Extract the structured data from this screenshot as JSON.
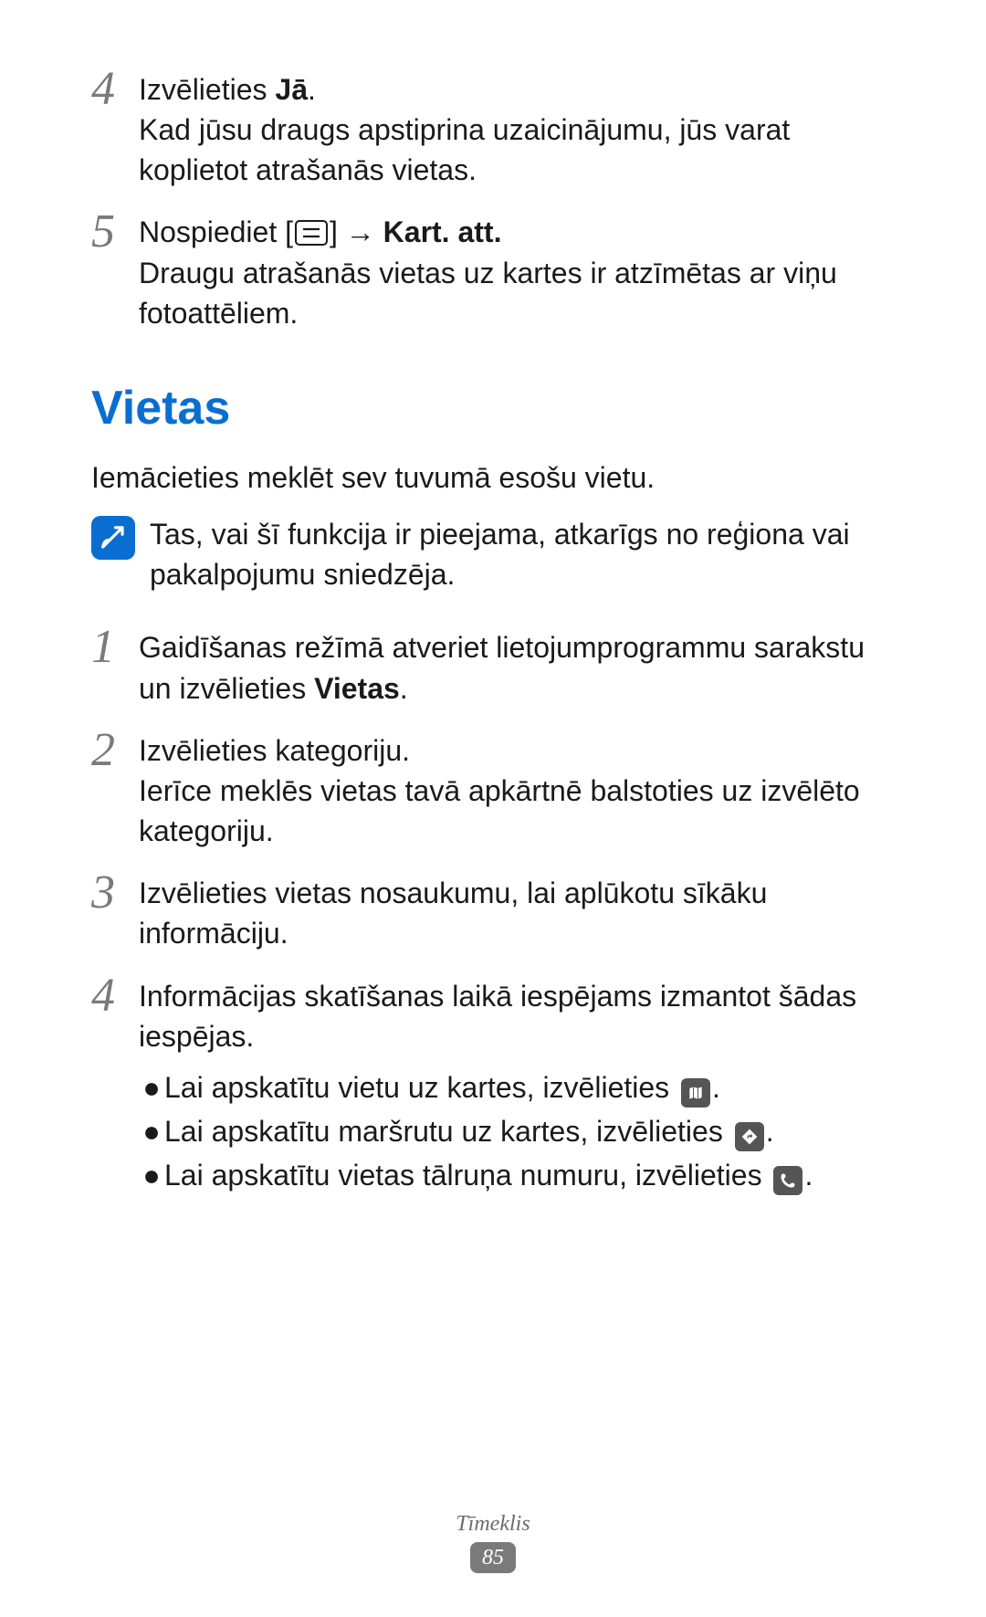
{
  "top_steps": [
    {
      "num": "4",
      "lines": [
        {
          "prefix": "Izvēlieties ",
          "bold": "Jā",
          "suffix": "."
        },
        {
          "text": "Kad jūsu draugs apstiprina uzaicinājumu, jūs varat koplietot atrašanās vietas."
        }
      ]
    },
    {
      "num": "5",
      "lines": [
        {
          "special": "menu_line",
          "prefix": "Nospiediet [",
          "suffix": "] → ",
          "bold": "Kart. att."
        },
        {
          "text": "Draugu atrašanās vietas uz kartes ir atzīmētas ar viņu fotoattēliem."
        }
      ]
    }
  ],
  "section_title": "Vietas",
  "intro": "Iemācieties meklēt sev tuvumā esošu vietu.",
  "note": "Tas, vai šī funkcija ir pieejama, atkarīgs no reģiona vai pakalpojumu sniedzēja.",
  "steps": [
    {
      "num": "1",
      "lines": [
        {
          "prefix": "Gaidīšanas režīmā atveriet lietojumprogrammu sarakstu un izvēlieties ",
          "bold": "Vietas",
          "suffix": "."
        }
      ]
    },
    {
      "num": "2",
      "lines": [
        {
          "text": "Izvēlieties kategoriju."
        },
        {
          "text": "Ierīce meklēs vietas tavā apkārtnē balstoties uz izvēlēto kategoriju."
        }
      ]
    },
    {
      "num": "3",
      "lines": [
        {
          "text": "Izvēlieties vietas nosaukumu, lai aplūkotu sīkāku informāciju."
        }
      ]
    },
    {
      "num": "4",
      "lines": [
        {
          "text": "Informācijas skatīšanas laikā iespējams izmantot šādas iespējas."
        }
      ],
      "bullets": [
        {
          "text": "Lai apskatītu vietu uz kartes, izvēlieties ",
          "icon": "map-icon"
        },
        {
          "text": "Lai apskatītu maršrutu uz kartes, izvēlieties ",
          "icon": "route-icon"
        },
        {
          "text": "Lai apskatītu vietas tālruņa numuru, izvēlieties ",
          "icon": "phone-icon"
        }
      ]
    }
  ],
  "footer": {
    "label": "Tīmeklis",
    "page": "85"
  }
}
